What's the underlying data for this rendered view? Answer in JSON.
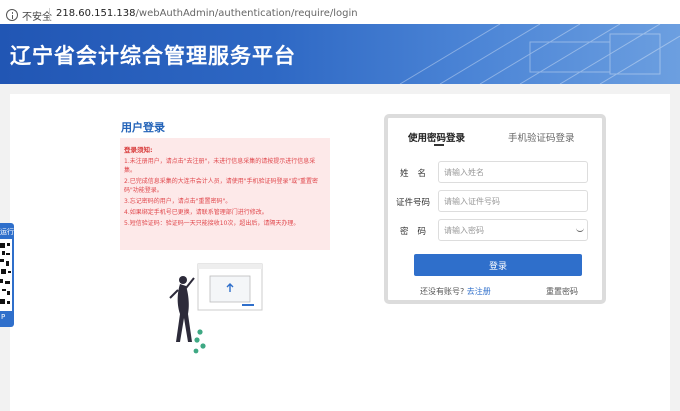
{
  "browser": {
    "insecure_label": "不安全",
    "url_host": "218.60.151.138",
    "url_path": "/webAuthAdmin/authentication/require/login"
  },
  "banner": {
    "title": "辽宁省会计综合管理服务平台"
  },
  "main": {
    "section_title": "用户登录",
    "notice": {
      "title": "登录须知:",
      "lines": [
        "1.未注册用户，请点击\"去注册\"，未进行信息采集的请按提示进行信息采集。",
        "2.已完成信息采集的大连市会计人员，请使用\"手机验证码登录\"或\"重置密码\"功能登录。",
        "3.忘记密码的用户，请点击\"重置密码\"。",
        "4.如果绑定手机号已更换，请联系管理部门进行修改。",
        "5.短信验证码：验证码一天只能接收10次，超出后，请隔天办理。"
      ]
    }
  },
  "side_tab": {
    "top_text": "运行",
    "bottom_text": "P"
  },
  "login": {
    "tabs": [
      {
        "label": "使用密码登录",
        "active": true
      },
      {
        "label": "手机验证码登录",
        "active": false
      }
    ],
    "name_label": "姓　名",
    "name_label_a": "姓",
    "name_label_b": "名",
    "name_placeholder": "请输入姓名",
    "id_label": "证件号码",
    "id_placeholder": "请输入证件号码",
    "pwd_label_a": "密",
    "pwd_label_b": "码",
    "pwd_placeholder": "请输入密码",
    "submit_label": "登录",
    "no_account_text": "还没有账号?",
    "register_link": "去注册",
    "reset_link": "重置密码"
  },
  "colors": {
    "brand_blue": "#2f6fcb",
    "notice_bg": "#fde9e9",
    "notice_text": "#e0474c"
  }
}
